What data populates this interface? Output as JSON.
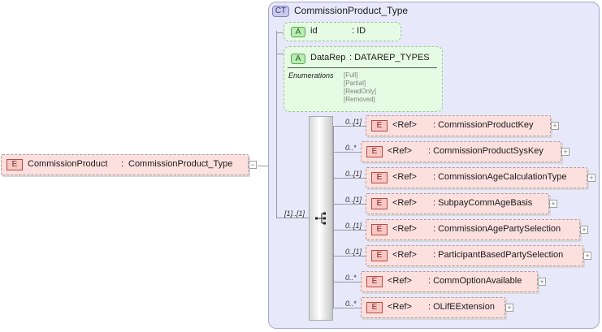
{
  "root": {
    "badge": "E",
    "name": "CommissionProduct",
    "type_sep": ":",
    "type": "CommissionProduct_Type",
    "collapse_glyph": "−"
  },
  "complex_type": {
    "badge": "CT",
    "title": "CommissionProduct_Type",
    "attributes": [
      {
        "badge": "A",
        "name": "id",
        "type": ": ID"
      },
      {
        "badge": "A",
        "name": "DataRep",
        "type": ": DATAREP_TYPES",
        "enum_label": "Enumerations",
        "enumerations": [
          "[Full]",
          "[Partial]",
          "[ReadOnly]",
          "[Removed]"
        ]
      }
    ],
    "sequence": {
      "cardinality": "[1]..[1]",
      "icon": "sequence-icon",
      "children": [
        {
          "card": "0..[1]",
          "badge": "E",
          "ref": "<Ref>",
          "name": ": CommissionProductKey",
          "expand": "+"
        },
        {
          "card": "0..*",
          "badge": "E",
          "ref": "<Ref>",
          "name": ": CommissionProductSysKey",
          "expand": "+"
        },
        {
          "card": "0..[1]",
          "badge": "E",
          "ref": "<Ref>",
          "name": ": CommissionAgeCalculationType",
          "expand": "+"
        },
        {
          "card": "0..[1]",
          "badge": "E",
          "ref": "<Ref>",
          "name": ": SubpayCommAgeBasis",
          "expand": "+"
        },
        {
          "card": "0..[1]",
          "badge": "E",
          "ref": "<Ref>",
          "name": ": CommissionAgePartySelection",
          "expand": "+"
        },
        {
          "card": "0..[1]",
          "badge": "E",
          "ref": "<Ref>",
          "name": ": ParticipantBasedPartySelection",
          "expand": "+"
        },
        {
          "card": "0..*",
          "badge": "E",
          "ref": "<Ref>",
          "name": ": CommOptionAvailable",
          "expand": "+"
        },
        {
          "card": "0..*",
          "badge": "E",
          "ref": "<Ref>",
          "name": ": OLifEExtension",
          "expand": "+"
        }
      ]
    }
  },
  "colors": {
    "complex_type_bg": "#e8e8fb",
    "attribute_bg": "#e6fbe3",
    "element_bg": "#fce0de"
  }
}
